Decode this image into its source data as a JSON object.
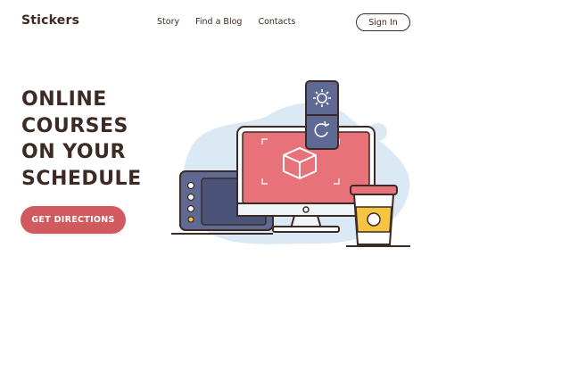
{
  "header": {
    "brand": "Stickers",
    "nav": [
      "Story",
      "Find a Blog",
      "Contacts"
    ],
    "signin_label": "Sign In"
  },
  "hero": {
    "title_lines": [
      "ONLINE",
      "COURSES",
      "ON YOUR",
      "SCHEDULE"
    ],
    "cta_label": "GET DIRECTIONS"
  },
  "illustration": {
    "icons": [
      "sun-icon",
      "refresh-icon",
      "cube-icon"
    ],
    "colors": {
      "dark": "#3d2a25",
      "blob": "#dbe9f4",
      "screen": "#e8727a",
      "panel": "#5f6a94",
      "cup": "#f5c542",
      "accent": "#d05a5e"
    }
  }
}
